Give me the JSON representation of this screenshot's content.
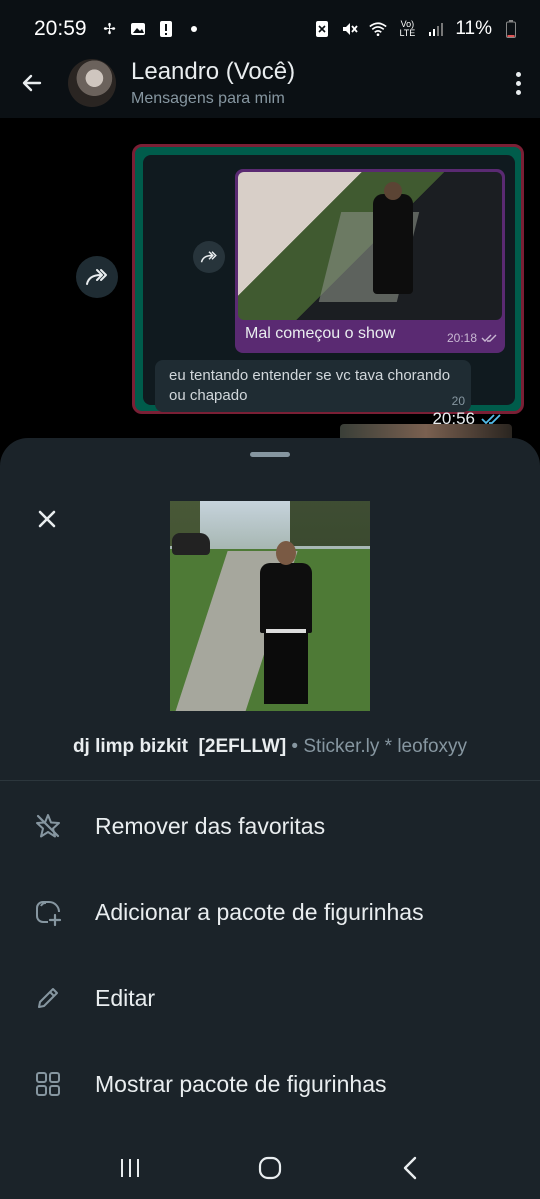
{
  "status_bar": {
    "time": "20:59",
    "battery": "11%",
    "left_icons": [
      "fan-icon",
      "image-icon",
      "alert-icon",
      "dot-icon"
    ],
    "right_icons": [
      "nfc-icon",
      "mute-icon",
      "wifi-icon",
      "volte-icon",
      "signal-icon",
      "battery-icon"
    ]
  },
  "header": {
    "contact_name": "Leandro (Você)",
    "subtitle": "Mensagens para mim"
  },
  "chat": {
    "quoted_caption": "Mal começou o show",
    "quoted_time": "20:18",
    "message_text": "eu tentando entender se vc tava chorando ou chapado",
    "message_time_partial": "20",
    "outer_time": "20:56"
  },
  "sheet": {
    "sticker_name": "dj limp bizkit  [2EFLLW]",
    "sticker_pack": " • Sticker.ly * leofoxyy",
    "actions": [
      {
        "label": "Remover das favoritas",
        "icon": "star-off-icon"
      },
      {
        "label": "Adicionar a pacote de figurinhas",
        "icon": "sticker-add-icon"
      },
      {
        "label": "Editar",
        "icon": "pencil-icon"
      },
      {
        "label": "Mostrar pacote de figurinhas",
        "icon": "grid-icon"
      }
    ]
  },
  "colors": {
    "sheet_bg": "#1b2329",
    "bubble_green": "#005c4b",
    "read_tick": "#53bdeb",
    "text_primary": "#e9edef",
    "text_secondary": "#8696a0"
  }
}
